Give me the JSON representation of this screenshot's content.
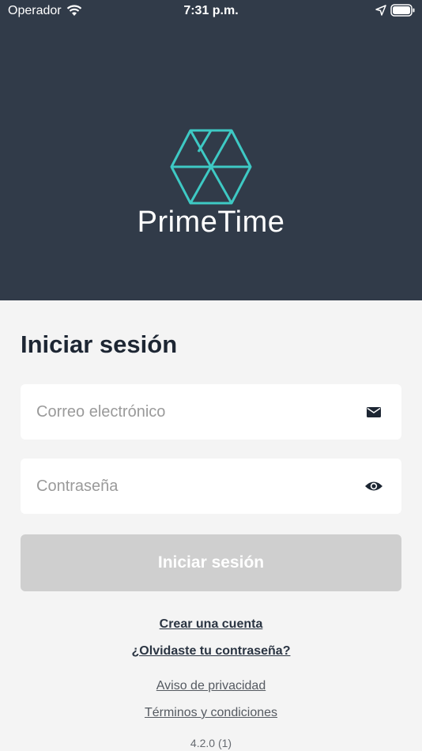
{
  "status_bar": {
    "carrier": "Operador",
    "time": "7:31 p.m."
  },
  "brand": {
    "name": "PrimeTime",
    "accent_color": "#3ec9c4"
  },
  "login": {
    "title": "Iniciar sesión",
    "email_placeholder": "Correo electrónico",
    "password_placeholder": "Contraseña",
    "submit_label": "Iniciar sesión",
    "email_icon": "envelope-icon",
    "password_icon": "eye-icon"
  },
  "links": {
    "create_account": "Crear una cuenta",
    "forgot_password": "¿Olvidaste tu contraseña?",
    "privacy": "Aviso de privacidad",
    "terms": "Términos y condiciones"
  },
  "version": "4.2.0 (1)",
  "colors": {
    "hero_bg": "#313b49",
    "page_bg": "#f4f4f4",
    "button_disabled": "#cfcfcf"
  }
}
